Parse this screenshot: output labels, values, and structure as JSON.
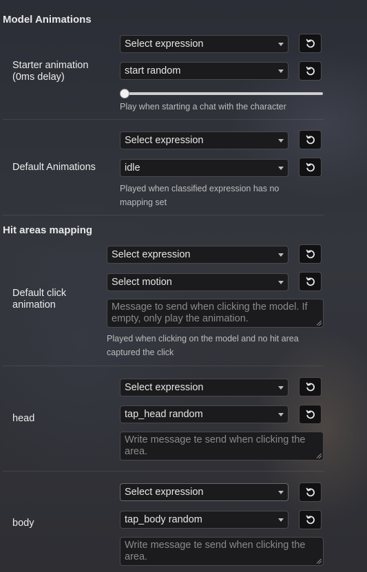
{
  "model_animations": {
    "title": "Model Animations",
    "starter": {
      "label": "Starter animation (0ms delay)",
      "expression": "Select expression",
      "motion": "start random",
      "delay_slider_value": 0,
      "hint": "Play when starting a chat with the character"
    },
    "default": {
      "label": "Default Animations",
      "expression": "Select expression",
      "motion": "idle",
      "hint": "Played when classified expression has no mapping set"
    }
  },
  "hit_areas": {
    "title": "Hit areas mapping",
    "default_click": {
      "label": "Default click animation",
      "expression": "Select expression",
      "motion": "Select motion",
      "message_placeholder": "Message to send when clicking the model. If empty, only play the animation.",
      "hint": "Played when clicking on the model and no hit area captured the click"
    },
    "areas": [
      {
        "label": "head",
        "expression": "Select expression",
        "motion": "tap_head random",
        "message_placeholder": "Write message te send when clicking the area."
      },
      {
        "label": "body",
        "expression": "Select expression",
        "motion": "tap_body random",
        "message_placeholder": "Write message te send when clicking the area."
      }
    ]
  },
  "icons": {
    "reset": "undo-arrow-icon",
    "dropdown": "chevron-down-icon",
    "resize": "resize-grip-icon"
  }
}
